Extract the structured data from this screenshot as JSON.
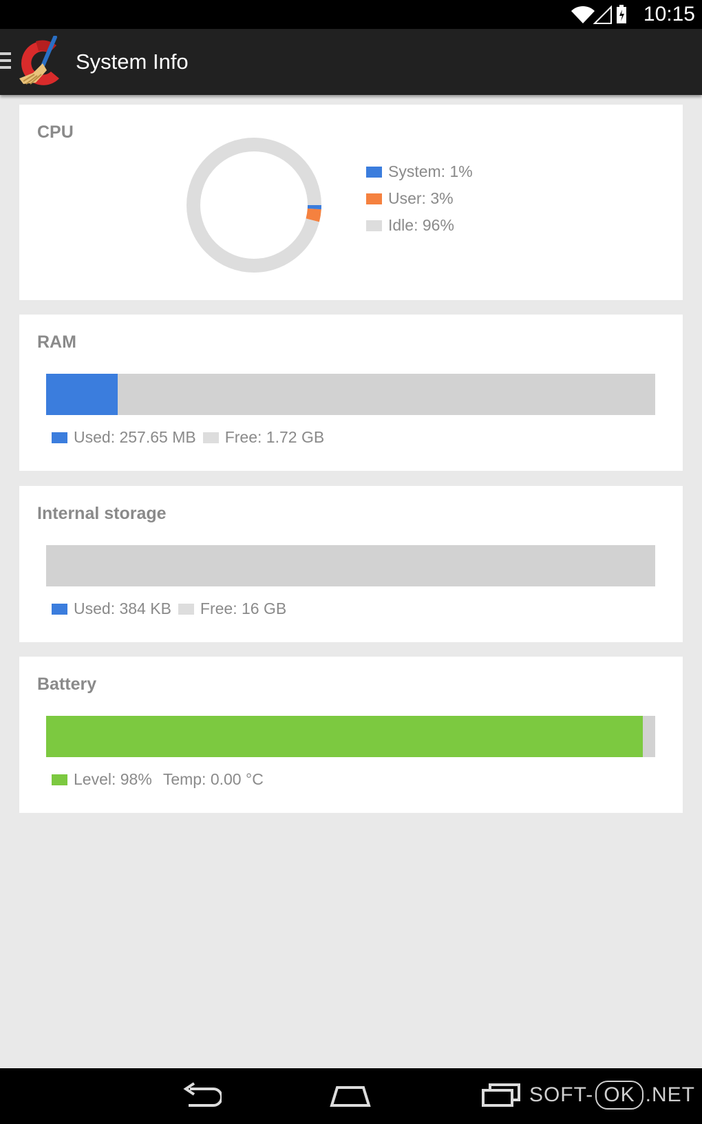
{
  "status_bar": {
    "time": "10:15",
    "icons": [
      "wifi-icon",
      "signal-icon",
      "battery-icon"
    ]
  },
  "action_bar": {
    "title": "System Info",
    "menu_icon": "menu-icon",
    "logo": "ccleaner-logo"
  },
  "cpu": {
    "title": "CPU",
    "legend": [
      {
        "label": "System: 1%",
        "color": "#3b7ddd",
        "value": 1
      },
      {
        "label": "User: 3%",
        "color": "#f5813f",
        "value": 3
      },
      {
        "label": "Idle: 96%",
        "color": "#dddddd",
        "value": 96
      }
    ]
  },
  "ram": {
    "title": "RAM",
    "used_label": "Used: 257.65 MB",
    "free_label": "Free: 1.72 GB",
    "used_fraction": 0.118,
    "used_color": "#3b7ddd",
    "free_color": "#d2d2d2"
  },
  "storage": {
    "title": "Internal storage",
    "used_label": "Used: 384 KB",
    "free_label": "Free: 16 GB",
    "used_fraction": 0.0,
    "used_color": "#3b7ddd",
    "free_color": "#d2d2d2"
  },
  "battery": {
    "title": "Battery",
    "level_label": "Level: 98%",
    "temp_label": "Temp: 0.00 °C",
    "level_fraction": 0.98,
    "level_color": "#7cc940"
  },
  "nav_bar": {
    "buttons": [
      "back-icon",
      "home-icon",
      "recents-icon"
    ]
  },
  "watermark": {
    "left": "SOFT-",
    "middle": "OK",
    "right": ".NET"
  }
}
